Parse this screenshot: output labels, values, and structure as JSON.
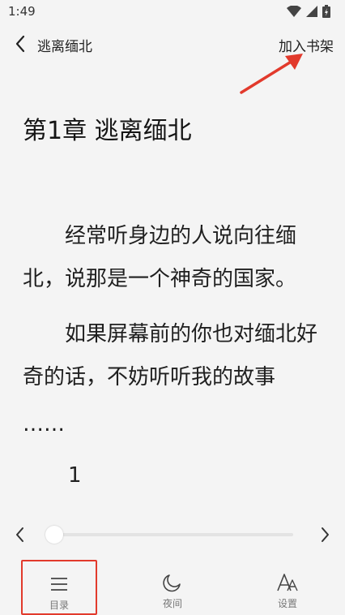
{
  "status_bar": {
    "time": "1:49"
  },
  "header": {
    "book_title": "逃离缅北",
    "add_to_shelf": "加入书架"
  },
  "chapter": {
    "title": "第1章 逃离缅北",
    "paragraphs": [
      "　　经常听身边的人说向往缅北，说那是一个神奇的国家。",
      "　　如果屏幕前的你也对缅北好奇的话，不妨听听我的故事"
    ],
    "ellipsis": "……",
    "page_number": "1"
  },
  "progress": {
    "fraction": 0.0
  },
  "bottom_bar": {
    "menu": "目录",
    "night": "夜间",
    "settings": "设置"
  },
  "colors": {
    "highlight": "#e23a2c",
    "background": "#f4f4f4"
  }
}
